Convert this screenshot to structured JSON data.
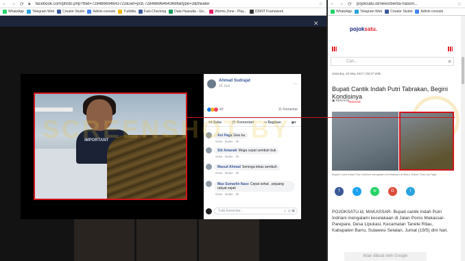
{
  "left_window": {
    "url": "facebook.com/photo.php?fbid=728486694643723&set=pcb.728486964643696&type=3&theater",
    "bookmarks": [
      {
        "label": "WhatsApp",
        "color": "#25d366"
      },
      {
        "label": "Telegram Web",
        "color": "#2aa3df"
      },
      {
        "label": "Creator Studio",
        "color": "#3b5998"
      },
      {
        "label": "Admin console",
        "color": "#4285f4"
      },
      {
        "label": "Tudidtia",
        "color": "#f4b400"
      },
      {
        "label": "Fact-Checking",
        "color": "#3b5998"
      },
      {
        "label": "Data Huasulta - Go...",
        "color": "#0f9d58"
      },
      {
        "label": "Worms Zone - Play...",
        "color": "#e91e63"
      },
      {
        "label": "OSINT Framework",
        "color": "#333333"
      }
    ],
    "post": {
      "author": "Ahmad Sudrajat",
      "date": "15 Juni",
      "reaction_count": "40",
      "comment_count": "11 Komentar",
      "actions": [
        "Suka",
        "Komentari",
        "Bagikan"
      ],
      "shirt_text": "IMPORTANT",
      "comments": [
        {
          "name": "Ani Paga",
          "text": "Gws bu",
          "meta": "Suka · Balas · 3h"
        },
        {
          "name": "Siti Amanah",
          "text": "Moga cepat sembuh buk",
          "meta": "Suka · Balas · 3h"
        },
        {
          "name": "Masud Ahmad",
          "text": "Semoga lekas sembuh",
          "meta": "Suka · Balas · 3h"
        },
        {
          "name": "Mas Sumarlin Nase",
          "text": "Cepat sehat . pejuang rakyat sejati",
          "meta": "Suka · Balas · 3h"
        }
      ],
      "comment_placeholder": "Tulis komentar..."
    },
    "watermark": "SCREENSHOT BY"
  },
  "right_window": {
    "url": "pojoksatu.id/news/berita-nasion...",
    "bookmarks": [
      {
        "label": "WhatsApp",
        "color": "#25d366"
      },
      {
        "label": "Telegram Web",
        "color": "#2aa3df"
      },
      {
        "label": "Creator Studio",
        "color": "#3b5998"
      },
      {
        "label": "Admin console",
        "color": "#4285f4"
      }
    ],
    "logo_main": "pojok",
    "logo_accent": "satu.",
    "search_placeholder": "Cari...",
    "date": "Saturday, 20 May 2017 | 09:37 WIB",
    "title": "Bupati Cantik Indah Putri Tabrakan, Begini Kondisinya",
    "author": "REDAKSI",
    "category": "Nasional",
    "caption": "Bupati Luwu Indah Putri Indriani mengalami kecelakaan di Barru Sulsel. Foto via Fajar",
    "share": [
      {
        "label": "f",
        "color": "#3b5998"
      },
      {
        "label": "t",
        "color": "#1da1f2"
      },
      {
        "label": "w",
        "color": "#25d366"
      },
      {
        "label": "G",
        "color": "#dd4b39"
      },
      {
        "label": "l",
        "color": "#2aa3df"
      }
    ],
    "body": "POJOKSATU.id, MAKASSAR- Bupati cantik Indah Putri Indriani mengalami kecelakaan di Jalan Poros Makassar-Parepare, Desa Lipukasi, Kecamatan Tanete Rilau, Kabupaten Barru, Sulawesi Selatan, Jumat (19/5) dini hari.",
    "ad_text": "Iklan dibuat oleh Google"
  }
}
